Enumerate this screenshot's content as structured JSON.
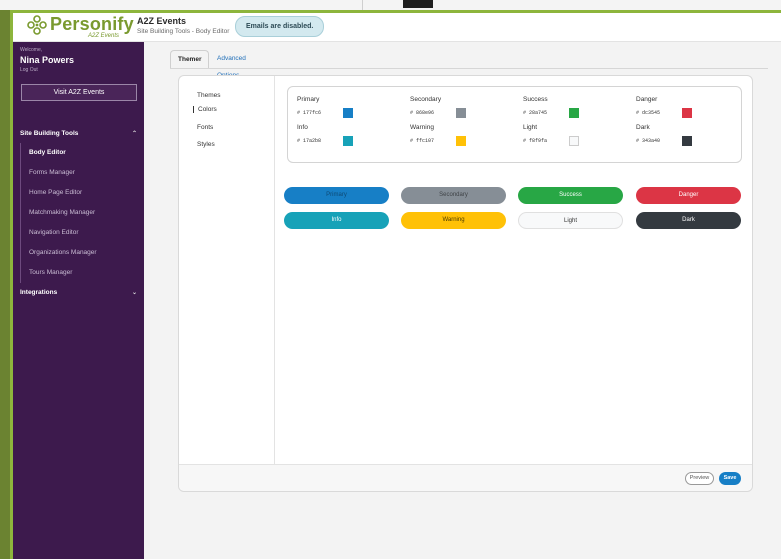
{
  "header": {
    "logo_text": "Personify",
    "logo_sub": "A2Z Events",
    "app_title": "A2Z Events",
    "app_subtitle": "Site Building Tools - Body Editor",
    "email_notice": "Emails are disabled."
  },
  "sidebar": {
    "welcome": "Welcome,",
    "user_name": "Nina Powers",
    "logout": "Log Out",
    "visit_button": "Visit A2Z Events",
    "section_tools": "Site Building Tools",
    "items": [
      {
        "label": "Body Editor",
        "active": true
      },
      {
        "label": "Forms Manager"
      },
      {
        "label": "Home Page Editor"
      },
      {
        "label": "Matchmaking Manager"
      },
      {
        "label": "Navigation Editor"
      },
      {
        "label": "Organizations Manager"
      },
      {
        "label": "Tours Manager"
      }
    ],
    "section_integrations": "Integrations"
  },
  "tabs": [
    {
      "label": "Themer",
      "active": true
    },
    {
      "label": "Advanced Options"
    }
  ],
  "side_nav": [
    {
      "label": "Themes"
    },
    {
      "label": "Colors",
      "selected": true
    },
    {
      "label": "Fonts"
    },
    {
      "label": "Styles"
    }
  ],
  "colors": [
    {
      "name": "Primary",
      "hex": "177fc6",
      "color": "#177fc6"
    },
    {
      "name": "Secondary",
      "hex": "868e96",
      "color": "#868e96"
    },
    {
      "name": "Success",
      "hex": "28a745",
      "color": "#28a745"
    },
    {
      "name": "Danger",
      "hex": "dc3545",
      "color": "#dc3545"
    },
    {
      "name": "Info",
      "hex": "17a2b8",
      "color": "#17a2b8"
    },
    {
      "name": "Warning",
      "hex": "ffc107",
      "color": "#ffc107"
    },
    {
      "name": "Light",
      "hex": "f8f9fa",
      "color": "#f8f9fa"
    },
    {
      "name": "Dark",
      "hex": "343a40",
      "color": "#343a40"
    }
  ],
  "hash": "#",
  "preview_buttons": [
    {
      "label": "Primary",
      "bg": "#177fc6",
      "fg": "#0e4a75"
    },
    {
      "label": "Secondary",
      "bg": "#868e96",
      "fg": "#3f4347"
    },
    {
      "label": "Success",
      "bg": "#28a745",
      "fg": "#ffffff"
    },
    {
      "label": "Danger",
      "bg": "#dc3545",
      "fg": "#ffffff"
    },
    {
      "label": "Info",
      "bg": "#17a2b8",
      "fg": "#ffffff"
    },
    {
      "label": "Warning",
      "bg": "#ffc107",
      "fg": "#4a3a00"
    },
    {
      "label": "Light",
      "bg": "#f8f9fa",
      "fg": "#333333"
    },
    {
      "label": "Dark",
      "bg": "#343a40",
      "fg": "#ffffff"
    }
  ],
  "footer": {
    "preview": "Preview",
    "save": "Save"
  }
}
